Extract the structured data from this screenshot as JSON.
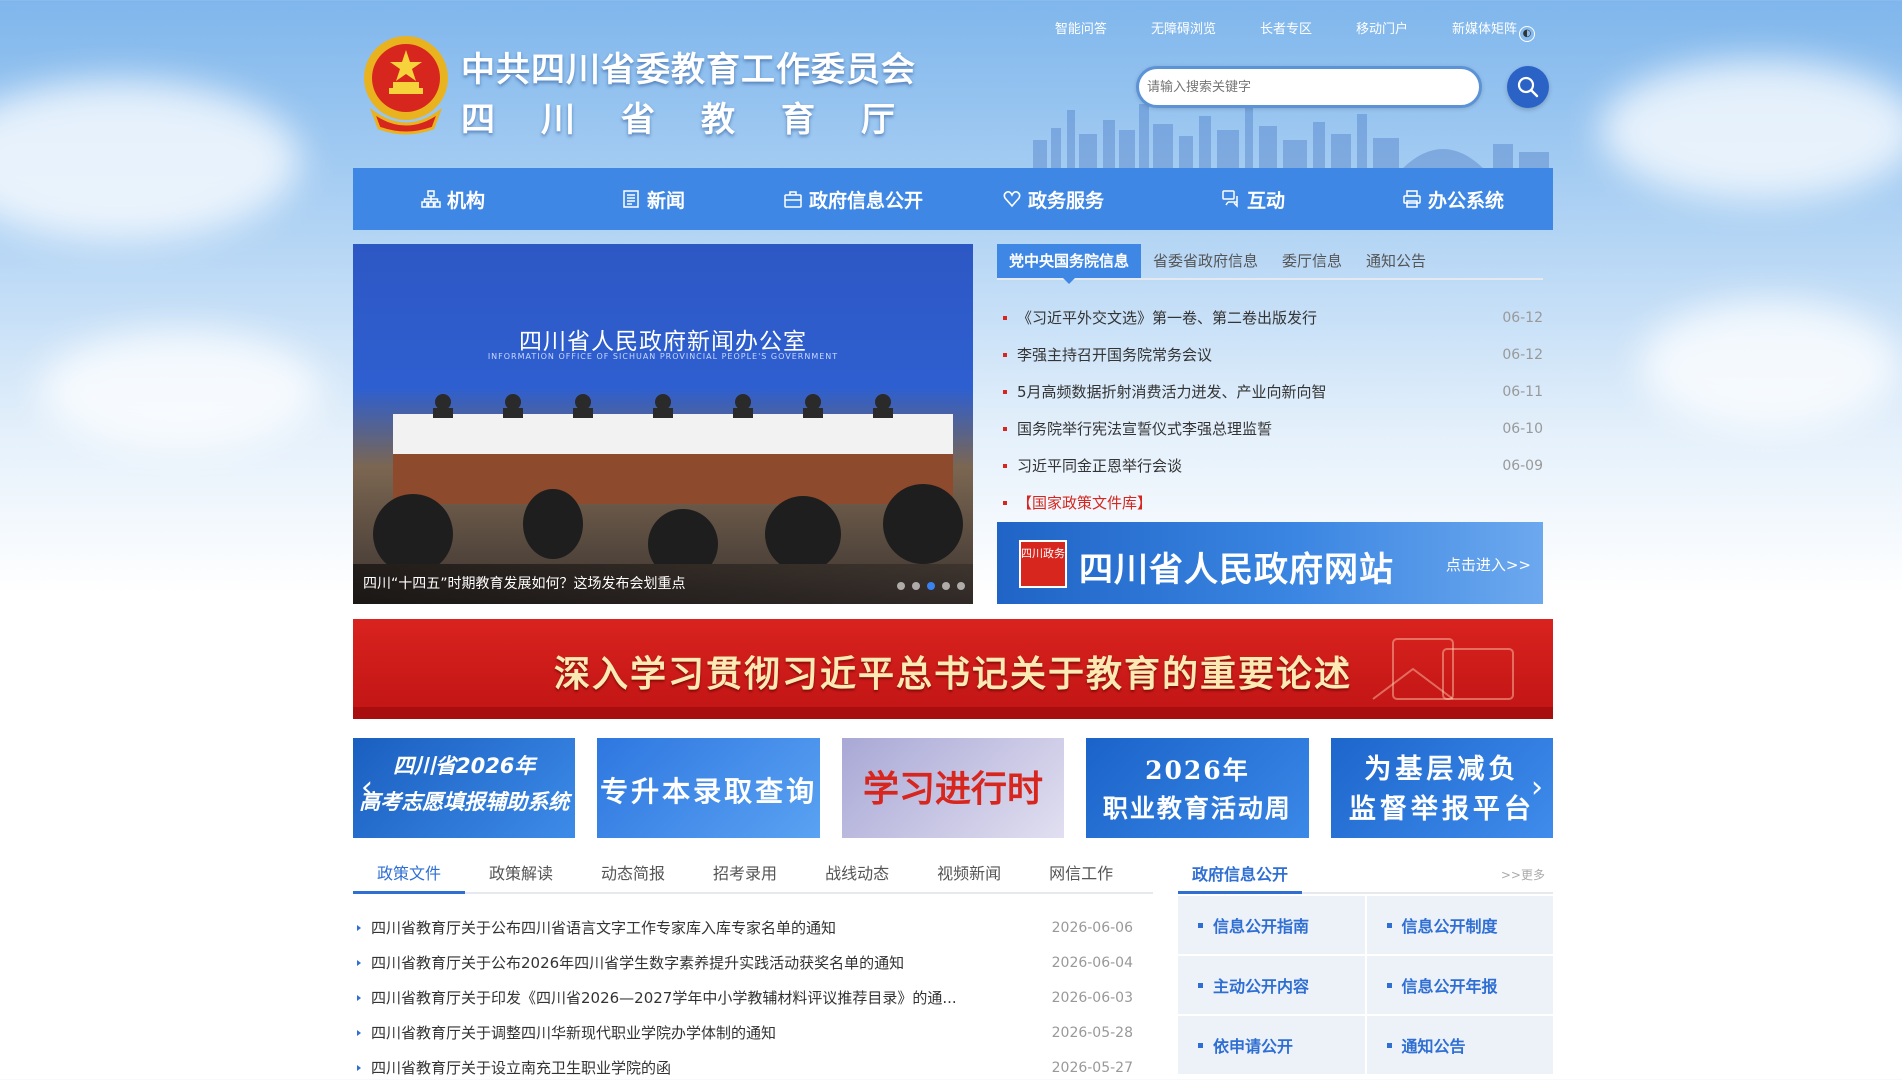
{
  "header": {
    "title_line1": "中共四川省委教育工作委员会",
    "title_line2": "四川省教育厅",
    "top_links": [
      "智能问答",
      "无障碍浏览",
      "长者专区",
      "移动门户",
      "新媒体矩阵"
    ],
    "search_placeholder": "请输入搜索关键字"
  },
  "nav": [
    {
      "label": "机构",
      "icon": "org-chart-icon"
    },
    {
      "label": "新闻",
      "icon": "document-icon"
    },
    {
      "label": "政府信息公开",
      "icon": "briefcase-icon"
    },
    {
      "label": "政务服务",
      "icon": "heart-hand-icon"
    },
    {
      "label": "互动",
      "icon": "chat-icon"
    },
    {
      "label": "办公系统",
      "icon": "printer-icon"
    }
  ],
  "slider": {
    "slide_title": "四川省人民政府新闻办公室",
    "slide_subtitle": "INFORMATION OFFICE OF SICHUAN PROVINCIAL PEOPLE'S GOVERNMENT",
    "caption": "四川“十四五”时期教育发展如何？这场发布会划重点",
    "dot_count": 5,
    "active_dot": 2
  },
  "news_tabs": {
    "tabs": [
      "党中央国务院信息",
      "省委省政府信息",
      "委厅信息",
      "通知公告"
    ],
    "active": 0,
    "items": [
      {
        "title": "《习近平外交文选》第一卷、第二卷出版发行",
        "date": "06-12"
      },
      {
        "title": "李强主持召开国务院常务会议",
        "date": "06-12"
      },
      {
        "title": "5月高频数据折射消费活力迸发、产业向新向智",
        "date": "06-11"
      },
      {
        "title": "国务院举行宪法宣誓仪式李强总理监誓",
        "date": "06-10"
      },
      {
        "title": "习近平同金正恩举行会谈",
        "date": "06-09"
      },
      {
        "title": "【国家政策文件库】",
        "date": ""
      }
    ]
  },
  "gov_banner": {
    "seal_text": "四川政务",
    "name": "四川省人民政府网站",
    "enter": "点击进入>>"
  },
  "red_banner": "深入学习贯彻习近平总书记关于教育的重要论述",
  "thumbs": [
    {
      "line1": "四川省2026年",
      "line2": "高考志愿填报辅助系统"
    },
    {
      "line1": "专升本录取查询",
      "line2": ""
    },
    {
      "line1": "学习进行时",
      "line2": ""
    },
    {
      "line1": "2026年",
      "line2": "职业教育活动周"
    },
    {
      "line1": "为基层减负",
      "line2": "监督举报平台"
    }
  ],
  "policy": {
    "tabs": [
      "政策文件",
      "政策解读",
      "动态简报",
      "招考录用",
      "战线动态",
      "视频新闻",
      "网信工作"
    ],
    "active": 0,
    "items": [
      {
        "title": "四川省教育厅关于公布四川省语言文字工作专家库入库专家名单的通知",
        "date": "2026-06-06"
      },
      {
        "title": "四川省教育厅关于公布2026年四川省学生数字素养提升实践活动获奖名单的通知",
        "date": "2026-06-04"
      },
      {
        "title": "四川省教育厅关于印发《四川省2026—2027学年中小学教辅材料评议推荐目录》的通...",
        "date": "2026-06-03"
      },
      {
        "title": "四川省教育厅关于调整四川华新现代职业学院办学体制的通知",
        "date": "2026-05-28"
      },
      {
        "title": "四川省教育厅关于设立南充卫生职业学院的函",
        "date": "2026-05-27"
      }
    ]
  },
  "gov_info": {
    "title": "政府信息公开",
    "more": ">>更多",
    "cells": [
      "信息公开指南",
      "信息公开制度",
      "主动公开内容",
      "信息公开年报",
      "依申请公开",
      "通知公告"
    ]
  },
  "colors": {
    "nav_blue": "#3f87e4",
    "accent_blue": "#2f6fd3",
    "red": "#d7261e"
  }
}
